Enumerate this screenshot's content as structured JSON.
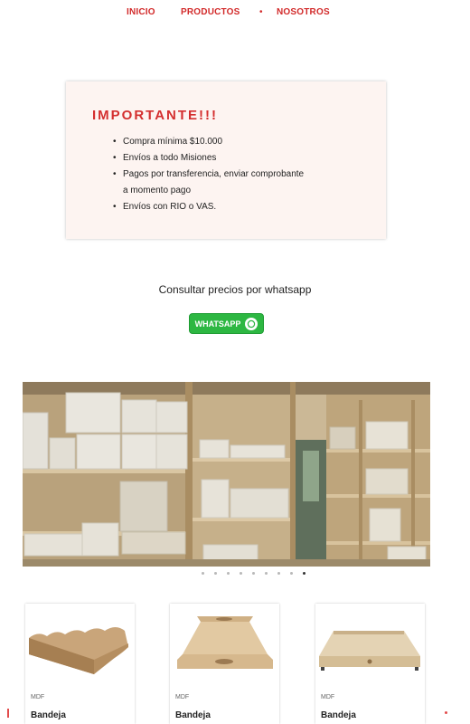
{
  "nav": {
    "inicio": "INICIO",
    "productos": "PRODUCTOS",
    "separator": "•",
    "nosotros": "NOSOTROS"
  },
  "notice": {
    "title": "IMPORTANTE!!!",
    "items": [
      "Compra mínima $10.000",
      "Envíos a todo Misiones",
      "Pagos por transferencia, enviar comprobante",
      "a momento pago",
      "Envíos con RIO o VAS."
    ]
  },
  "whatsapp": {
    "text": "Consultar precios por whatsapp",
    "button_label": "WHATSAPP",
    "color": "#2db742"
  },
  "slider": {
    "slide_count": 9,
    "active_index": 8
  },
  "products": [
    {
      "category": "MDF",
      "name": "Bandeja"
    },
    {
      "category": "MDF",
      "name": "Bandeja"
    },
    {
      "category": "MDF",
      "name": "Bandeja"
    }
  ],
  "colors": {
    "accent": "#d22a2a",
    "notice_bg": "#fdf4f1"
  }
}
